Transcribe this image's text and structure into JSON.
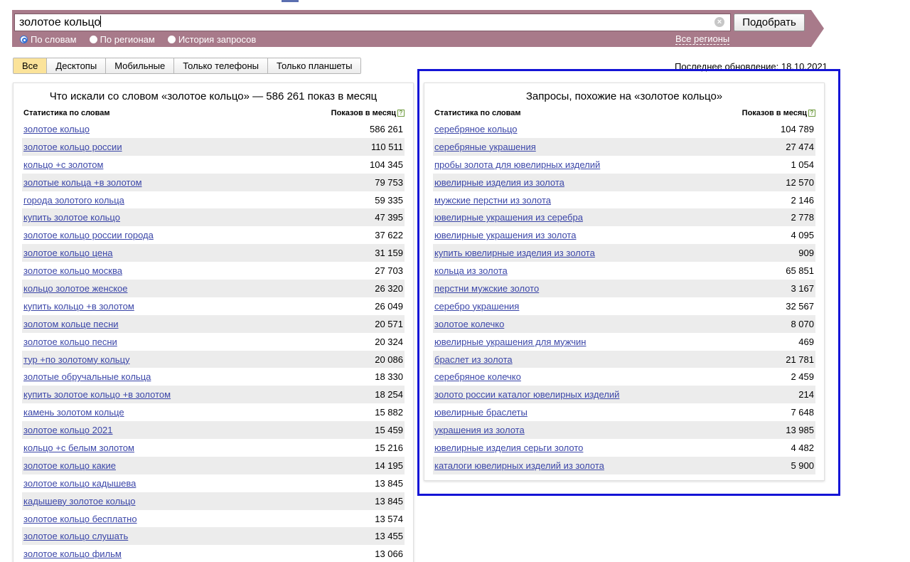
{
  "search": {
    "query": "золотое кольцо",
    "button_label": "Подобрать",
    "clear_icon": "clear-icon",
    "modes": [
      {
        "label": "По словам",
        "selected": true
      },
      {
        "label": "По регионам",
        "selected": false
      },
      {
        "label": "История запросов",
        "selected": false
      }
    ],
    "regions_link": "Все регионы"
  },
  "device_tabs": [
    {
      "label": "Все",
      "active": true
    },
    {
      "label": "Десктопы",
      "active": false
    },
    {
      "label": "Мобильные",
      "active": false
    },
    {
      "label": "Только телефоны",
      "active": false
    },
    {
      "label": "Только планшеты",
      "active": false
    }
  ],
  "last_update": "Последнее обновление: 18.10.2021",
  "left_panel": {
    "title": "Что искали со словом «золотое кольцо» — 586 261 показ в месяц",
    "col_phrase": "Статистика по словам",
    "col_count": "Показов в месяц",
    "rows": [
      {
        "phrase": "золотое кольцо",
        "count": "586 261"
      },
      {
        "phrase": "золотое кольцо россии",
        "count": "110 511"
      },
      {
        "phrase": "кольцо +с золотом",
        "count": "104 345"
      },
      {
        "phrase": "золотые кольца +в золотом",
        "count": "79 753"
      },
      {
        "phrase": "города золотого кольца",
        "count": "59 335"
      },
      {
        "phrase": "купить золотое кольцо",
        "count": "47 395"
      },
      {
        "phrase": "золотое кольцо россии города",
        "count": "37 622"
      },
      {
        "phrase": "золотое кольцо цена",
        "count": "31 159"
      },
      {
        "phrase": "золотое кольцо москва",
        "count": "27 703"
      },
      {
        "phrase": "кольцо золотое женское",
        "count": "26 320"
      },
      {
        "phrase": "купить кольцо +в золотом",
        "count": "26 049"
      },
      {
        "phrase": "золотом кольце песни",
        "count": "20 571"
      },
      {
        "phrase": "золотое кольцо песни",
        "count": "20 324"
      },
      {
        "phrase": "тур +по золотому кольцу",
        "count": "20 086"
      },
      {
        "phrase": "золотые обручальные кольца",
        "count": "18 330"
      },
      {
        "phrase": "купить золотое кольцо +в золотом",
        "count": "18 254"
      },
      {
        "phrase": "камень золотом кольце",
        "count": "15 882"
      },
      {
        "phrase": "золотое кольцо 2021",
        "count": "15 459"
      },
      {
        "phrase": "кольцо +с белым золотом",
        "count": "15 216"
      },
      {
        "phrase": "золотое кольцо какие",
        "count": "14 195"
      },
      {
        "phrase": "золотое кольцо кадышева",
        "count": "13 845"
      },
      {
        "phrase": "кадышеву золотое кольцо",
        "count": "13 845"
      },
      {
        "phrase": "золотое кольцо бесплатно",
        "count": "13 574"
      },
      {
        "phrase": "золотое кольцо слушать",
        "count": "13 455"
      },
      {
        "phrase": "золотое кольцо фильм",
        "count": "13 066"
      }
    ]
  },
  "right_panel": {
    "title": "Запросы, похожие на «золотое кольцо»",
    "col_phrase": "Статистика по словам",
    "col_count": "Показов в месяц",
    "rows": [
      {
        "phrase": "серебряное кольцо",
        "count": "104 789"
      },
      {
        "phrase": "серебряные украшения",
        "count": "27 474"
      },
      {
        "phrase": "пробы золота для ювелирных изделий",
        "count": "1 054"
      },
      {
        "phrase": "ювелирные изделия из золота",
        "count": "12 570"
      },
      {
        "phrase": "мужские перстни из золота",
        "count": "2 146"
      },
      {
        "phrase": "ювелирные украшения из серебра",
        "count": "2 778"
      },
      {
        "phrase": "ювелирные украшения из золота",
        "count": "4 095"
      },
      {
        "phrase": "купить ювелирные изделия из золота",
        "count": "909"
      },
      {
        "phrase": "кольца из золота",
        "count": "65 851"
      },
      {
        "phrase": "перстни мужские золото",
        "count": "3 167"
      },
      {
        "phrase": "серебро украшения",
        "count": "32 567"
      },
      {
        "phrase": "золотое колечко",
        "count": "8 070"
      },
      {
        "phrase": "ювелирные украшения для мужчин",
        "count": "469"
      },
      {
        "phrase": "браслет из золота",
        "count": "21 781"
      },
      {
        "phrase": "серебряное колечко",
        "count": "2 459"
      },
      {
        "phrase": "золото россии каталог ювелирных изделий",
        "count": "214"
      },
      {
        "phrase": "ювелирные браслеты",
        "count": "7 648"
      },
      {
        "phrase": "украшения из золота",
        "count": "13 985"
      },
      {
        "phrase": "ювелирные изделия серьги золото",
        "count": "4 482"
      },
      {
        "phrase": "каталоги ювелирных изделий из золота",
        "count": "5 900"
      }
    ]
  },
  "colors": {
    "search_bar": "#a87a8a",
    "link": "#3b46a8",
    "active_tab": "#fbe39a",
    "highlight_box": "#1414d6"
  }
}
